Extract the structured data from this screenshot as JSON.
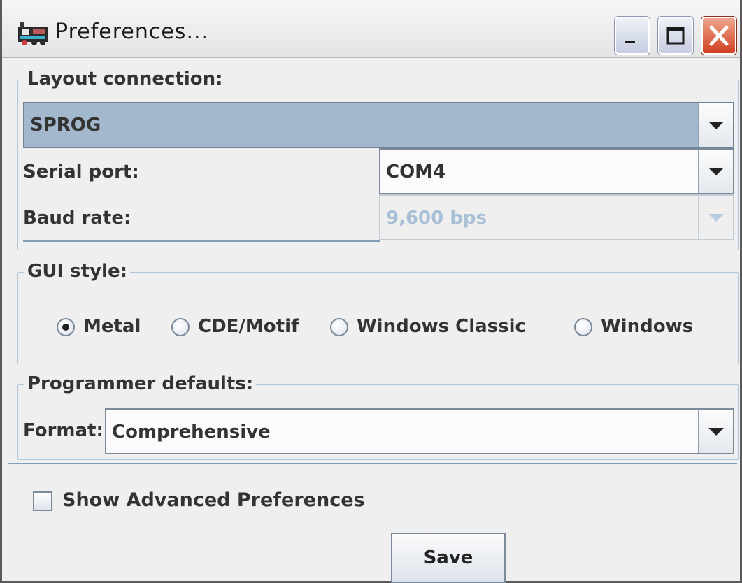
{
  "window": {
    "title": "Preferences...",
    "icon": "train-app-icon",
    "buttons": [
      "minimize-icon",
      "maximize-icon",
      "close-icon"
    ]
  },
  "layout_connection": {
    "legend": "Layout connection:",
    "selected": "SPROG",
    "serial_port_label": "Serial port:",
    "serial_port_value": "COM4",
    "baud_rate_label": "Baud rate:",
    "baud_rate_value": "9,600 bps",
    "baud_rate_enabled": false
  },
  "gui_style": {
    "legend": "GUI style:",
    "options": [
      {
        "label": "Metal",
        "selected": true
      },
      {
        "label": "CDE/Motif",
        "selected": false
      },
      {
        "label": "Windows Classic",
        "selected": false
      },
      {
        "label": "Windows",
        "selected": false
      }
    ]
  },
  "programmer_defaults": {
    "legend": "Programmer defaults:",
    "format_label": "Format:",
    "format_value": "Comprehensive"
  },
  "advanced": {
    "label": "Show Advanced Preferences",
    "checked": false
  },
  "save_label": "Save",
  "colors": {
    "selection": "#a3b8cc",
    "group_border": "#b3c7da",
    "disabled_text": "#a9bfd6",
    "close_button": "#d0401f"
  }
}
